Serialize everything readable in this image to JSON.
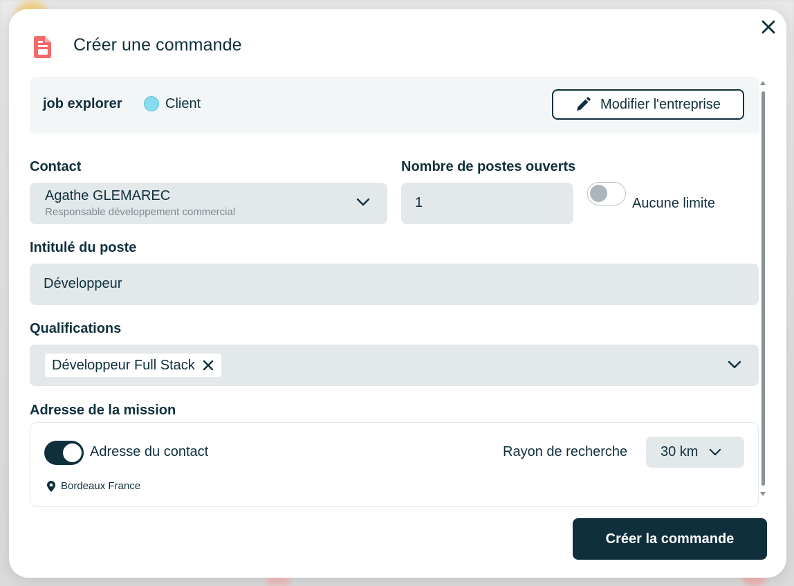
{
  "dialog": {
    "title": "Créer une commande",
    "icon": "document-icon",
    "close_icon": "close-icon",
    "accent_color": "#f26b6b"
  },
  "company": {
    "name": "job explorer",
    "type_label": "Client",
    "type_color": "#87dcf0",
    "edit_button_label": "Modifier l'entreprise",
    "edit_icon": "pencil-icon"
  },
  "contact": {
    "label": "Contact",
    "name": "Agathe GLEMAREC",
    "role": "Responsable développement commercial"
  },
  "openings": {
    "label": "Nombre de postes ouverts",
    "value": "1",
    "no_limit_label": "Aucune limite",
    "no_limit_enabled": false
  },
  "job_title": {
    "label": "Intitulé du poste",
    "value": "Développeur"
  },
  "qualifications": {
    "label": "Qualifications",
    "selected": [
      "Développeur Full Stack"
    ]
  },
  "mission_address": {
    "label": "Adresse de la mission",
    "use_contact_address_label": "Adresse du contact",
    "use_contact_address_enabled": true,
    "location": "Bordeaux France",
    "radius_label": "Rayon de recherche",
    "radius_value": "30 km"
  },
  "footer": {
    "submit_label": "Créer la commande"
  },
  "colors": {
    "primary": "#0f2f3c",
    "field_bg": "#e3e8ea",
    "panel_bg": "#f3f6f7"
  }
}
